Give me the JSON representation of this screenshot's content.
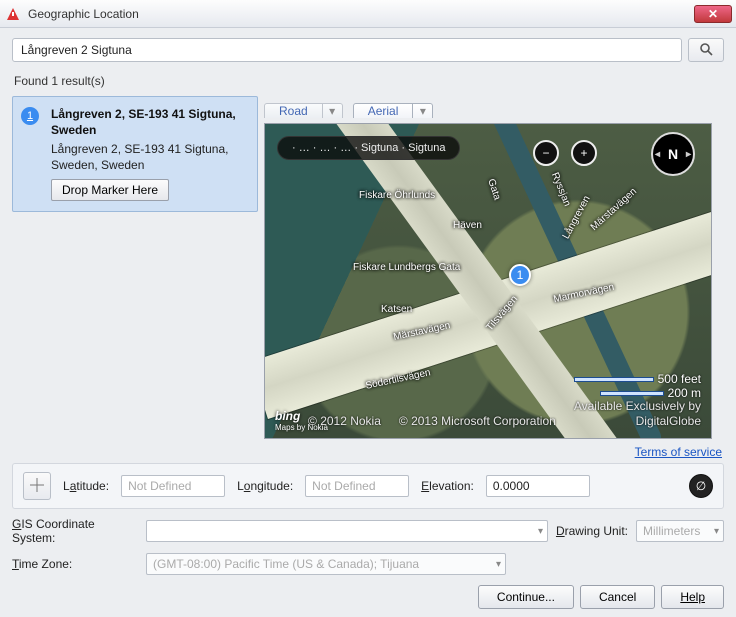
{
  "window": {
    "title": "Geographic Location"
  },
  "search": {
    "value": "Långreven 2 Sigtuna"
  },
  "results": {
    "count_text": "Found 1 result(s)",
    "items": [
      {
        "num": "1",
        "title": "Långreven 2, SE-193 41 Sigtuna, Sweden",
        "sub": "Långreven 2, SE-193 41 Sigtuna, Sweden, Sweden",
        "drop_label": "Drop Marker Here"
      }
    ]
  },
  "map": {
    "tabs": {
      "road": "Road",
      "aerial": "Aerial"
    },
    "breadcrumb": "· … · … · … · Sigtuna · Sigtuna",
    "marker_label": "1",
    "streets": {
      "ohrlunds": "Fiskare Öhrlunds",
      "gata": "Gata",
      "haven": "Häven",
      "ryssjan": "Ryssjan",
      "langreven": "Långreven",
      "marstavagen_top": "Märstavägen",
      "lundbergs": "Fiskare Lundbergs Gata",
      "katsen": "Katsen",
      "marstavagen_mid": "Märstavägen",
      "tilsvagen": "Tilsvägen",
      "marmorvagen": "Marmorvägen",
      "sodertilsvagen": "Södertilsvägen"
    },
    "scale": {
      "feet": "500 feet",
      "meters": "200 m"
    },
    "copy_nokia": "© 2012 Nokia",
    "copy_ms": "© 2013 Microsoft Corporation",
    "copy_dg": "Available Exclusively by\nDigitalGlobe",
    "bing": "bing",
    "bing_sub": "Maps by Nokia"
  },
  "tos": "Terms of service",
  "lle": {
    "latitude_label": "Latitude:",
    "latitude_ph": "Not Defined",
    "longitude_label": "Longitude:",
    "longitude_ph": "Not Defined",
    "elevation_label": "Elevation:",
    "elevation_val": "0.0000"
  },
  "gis": {
    "label": "GIS Coordinate System:",
    "value": ""
  },
  "drawing_unit": {
    "label": "Drawing Unit:",
    "value": "Millimeters"
  },
  "timezone": {
    "label": "Time Zone:",
    "value": "(GMT-08:00) Pacific Time (US & Canada); Tijuana"
  },
  "buttons": {
    "continue": "Continue...",
    "cancel": "Cancel",
    "help": "Help"
  }
}
